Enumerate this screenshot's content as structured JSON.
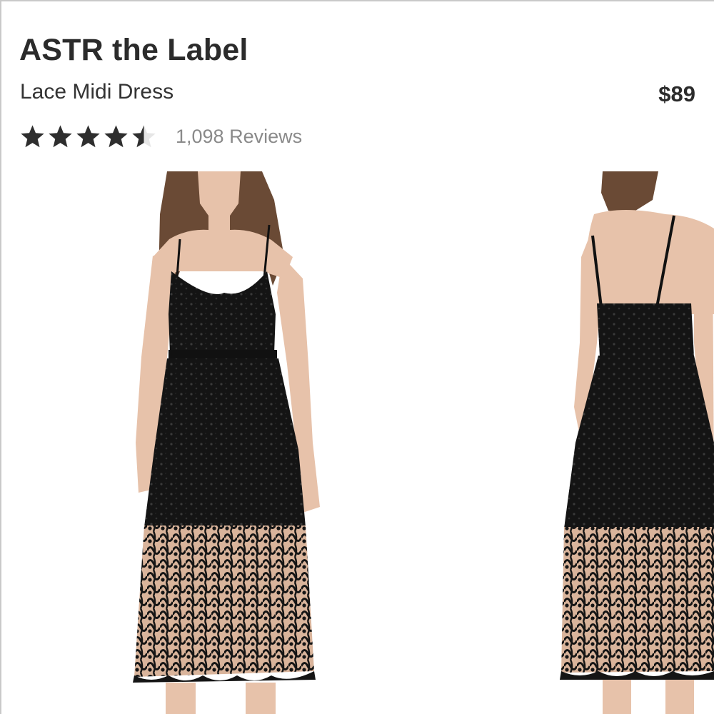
{
  "product": {
    "brand": "ASTR the Label",
    "name": "Lace Midi Dress",
    "price": "$89"
  },
  "rating": {
    "stars": 4.5,
    "max_stars": 5,
    "reviews_label": "1,098 Reviews"
  },
  "gallery": {
    "images": [
      {
        "icon": "model-front-photo",
        "view": "front"
      },
      {
        "icon": "model-back-photo",
        "view": "back"
      }
    ]
  },
  "colors": {
    "text_primary": "#2b2b2b",
    "text_secondary": "#8a8a8a",
    "star_filled": "#2e2e2e",
    "star_empty": "#e6e6e6",
    "dress": "#141414",
    "skin": "#e7c2aa",
    "hair": "#6a4a35"
  }
}
